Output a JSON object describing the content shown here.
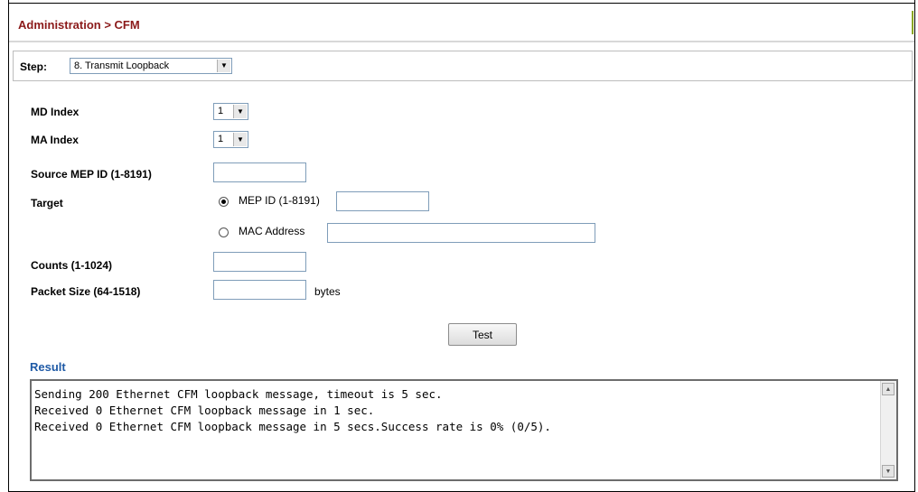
{
  "header": {
    "title": "Administration > CFM"
  },
  "step": {
    "label": "Step:",
    "selected": "8. Transmit Loopback"
  },
  "form": {
    "md_index": {
      "label": "MD Index",
      "value": "1"
    },
    "ma_index": {
      "label": "MA Index",
      "value": "1"
    },
    "source_mep": {
      "label": "Source MEP ID (1-8191)",
      "value": ""
    },
    "target": {
      "label": "Target",
      "options": [
        {
          "label": "MEP ID (1-8191)",
          "checked": true,
          "value": ""
        },
        {
          "label": "MAC Address",
          "checked": false,
          "value": ""
        }
      ]
    },
    "counts": {
      "label": "Counts (1-1024)",
      "value": ""
    },
    "packet_size": {
      "label": "Packet Size (64-1518)",
      "value": "",
      "unit": "bytes"
    }
  },
  "actions": {
    "test_label": "Test"
  },
  "result": {
    "title": "Result",
    "lines": [
      "Sending 200 Ethernet CFM loopback message, timeout is 5 sec.",
      "Received 0 Ethernet CFM loopback message in 1 sec.",
      "Received 0 Ethernet CFM loopback message in 5 secs.Success rate is 0% (0/5)."
    ]
  },
  "icons": {
    "dropdown": "chevron-down-icon",
    "scroll_up": "arrow-up-icon",
    "scroll_down": "arrow-down-icon"
  },
  "colors": {
    "title": "#8b1a1a",
    "result_title": "#1f5aa6",
    "accent": "#8aa624"
  }
}
